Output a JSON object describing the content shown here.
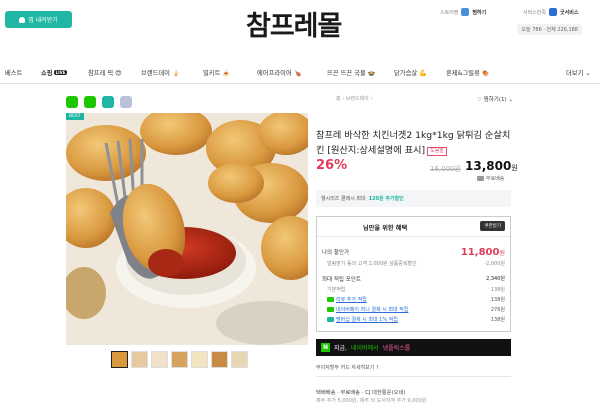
{
  "header": {
    "app_button": "앱 내려받기",
    "logo": "참프레몰",
    "utils": [
      {
        "label": "스토어찜",
        "value": "찜하기",
        "icon": "store-icon",
        "color": "#4a90d9"
      },
      {
        "label": "서비스만족",
        "value": "굿서비스",
        "icon": "thumbs-up-icon",
        "color": "#2b6fd6"
      }
    ],
    "visitors": "오늘 786 · 전체 226,188"
  },
  "nav": {
    "items": [
      "베스트",
      "쇼핑",
      "참프레 픽 😍",
      "브랜드데이 🍦",
      "밀키트 🍝",
      "에어프라이어 🍗",
      "뜨끈 뜨끈 국물 🍲",
      "닭가슴살 💪",
      "훈제&그릴류 🍖"
    ],
    "live_badge": "LIVE",
    "more": "더보기 ⌄"
  },
  "product": {
    "badge": "BEST",
    "breadcrumb": "홈 › 브랜드데이 ›",
    "wishlist": "♡ 찜하기(1) ⌄",
    "title": "참프레 바삭한 치킨너겟2 1kg*1kg 닭튀김 순살치킨 [원산지:상세설명에 표시]",
    "title_tag": "도움말",
    "discount": "26%",
    "original_price": "16,000원",
    "price": "13,800",
    "price_unit": "원",
    "shipping": "무료배송",
    "coupon_notice_pre": "웰시리즈 클래시 최대",
    "coupon_notice_highlight": "120원 추가할인",
    "colors": {
      "accent": "#1fb6a4",
      "sale": "#e03c5a",
      "naver": "#1ec800"
    }
  },
  "benefit": {
    "title": "님만을 위한 혜택",
    "coupon_button": "쿠폰받기",
    "my_price_label": "나의 할인가",
    "my_price": "11,800",
    "my_price_unit": "원",
    "discount_row_label": "알림받기 동의 고객 2,000원 상품중복할인",
    "discount_row_value": "-2,000원",
    "points_label": "최대 적립 포인트",
    "points_value": "2,340원",
    "base_points_label": "기본적립",
    "base_points_value": "138원",
    "point_rows": [
      {
        "label": "리뷰 추가 적립",
        "value": "138원",
        "color": "#1ec800",
        "icon": "review-icon"
      },
      {
        "label": "네이버페이 머니 결제 시 최대 적립",
        "value": "276원",
        "color": "#1ec800",
        "icon": "npay-icon"
      },
      {
        "label": "멤버십 결제 시 최대 1% 적립",
        "value": "138원",
        "color": "#1fb6a4",
        "icon": "membership-icon"
      }
    ]
  },
  "promo": {
    "pre": "지금,",
    "mid": "네이버에서",
    "post": "넷플릭스를"
  },
  "info_links": "무이자할부   카드 자세히보기 ?",
  "delivery": {
    "line1": "택배배송 · 무료배송 · CJ 대한통운(오네)",
    "line2": "제주 추가 5,000원, 제주 외 도서지역 추가 9,000원"
  },
  "thumbnails": [
    "thumb-1",
    "thumb-2",
    "thumb-3",
    "thumb-4",
    "thumb-5",
    "thumb-6",
    "thumb-7"
  ]
}
